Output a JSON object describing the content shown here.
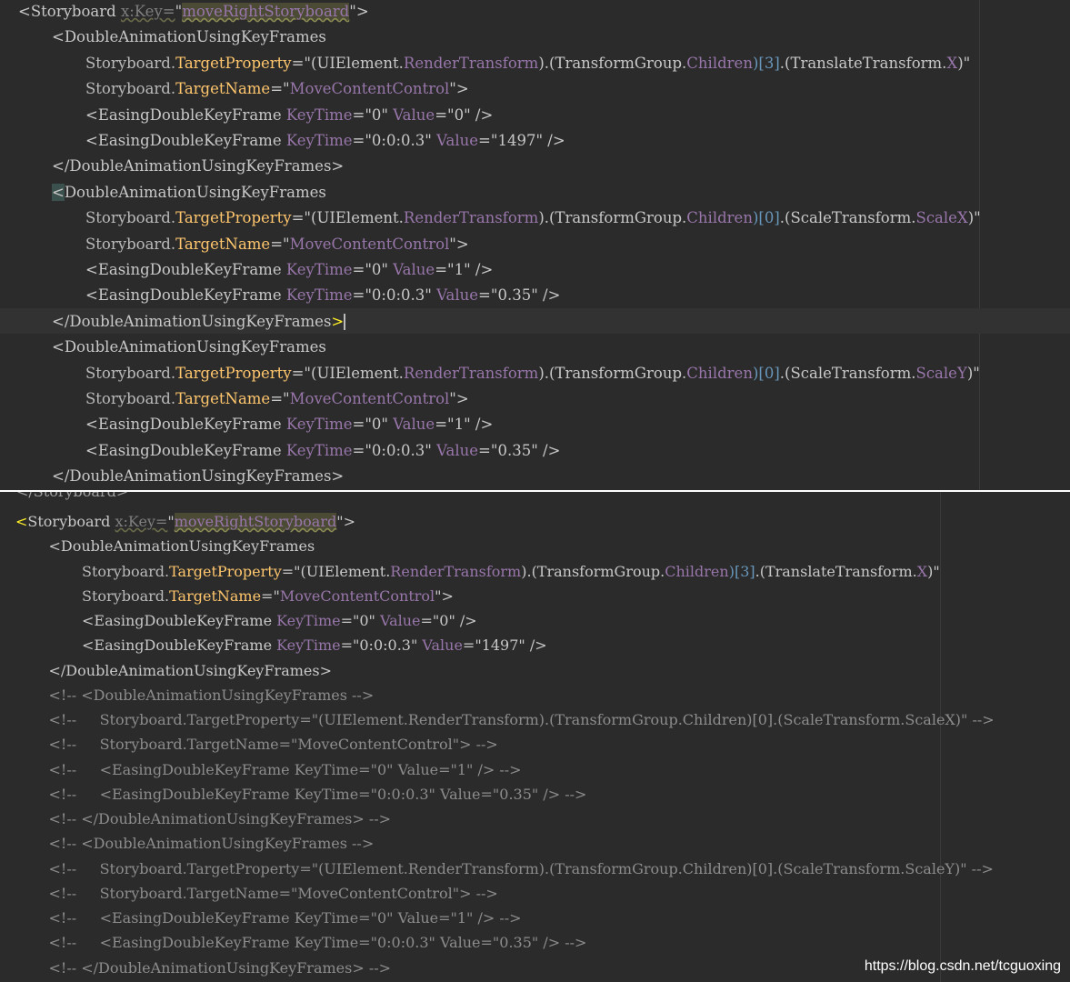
{
  "top_panel": {
    "lines": [
      {
        "indent": 0,
        "tokens": [
          {
            "t": "<Storyboard ",
            "c": "tag"
          },
          {
            "t": "x:Key=",
            "c": "key"
          },
          {
            "t": "\"",
            "c": "strq"
          },
          {
            "t": "moveRightStoryboard",
            "c": "keyval"
          },
          {
            "t": "\">",
            "c": "strq"
          }
        ]
      },
      {
        "indent": 1,
        "tokens": [
          {
            "t": "<DoubleAnimationUsingKeyFrames",
            "c": "tag"
          }
        ]
      },
      {
        "indent": 2,
        "tokens": [
          {
            "t": "Storyboard.",
            "c": "attr"
          },
          {
            "t": "TargetProperty",
            "c": "prop"
          },
          {
            "t": "=\"(UIElement.",
            "c": "strq"
          },
          {
            "t": "RenderTransform",
            "c": "str"
          },
          {
            "t": ").(TransformGroup.",
            "c": "strq"
          },
          {
            "t": "Children",
            "c": "str"
          },
          {
            "t": ")[3]",
            "c": "num"
          },
          {
            "t": ".(TranslateTransform.",
            "c": "strq"
          },
          {
            "t": "X",
            "c": "str"
          },
          {
            "t": ")\"",
            "c": "strq"
          }
        ]
      },
      {
        "indent": 2,
        "tokens": [
          {
            "t": "Storyboard.",
            "c": "attr"
          },
          {
            "t": "TargetName",
            "c": "prop"
          },
          {
            "t": "=\"",
            "c": "strq"
          },
          {
            "t": "MoveContentControl",
            "c": "str"
          },
          {
            "t": "\">",
            "c": "strq"
          }
        ]
      },
      {
        "indent": 2,
        "tokens": [
          {
            "t": "<EasingDoubleKeyFrame ",
            "c": "tag"
          },
          {
            "t": "KeyTime",
            "c": "str"
          },
          {
            "t": "=\"0\" ",
            "c": "strq"
          },
          {
            "t": "Value",
            "c": "str"
          },
          {
            "t": "=\"0\" />",
            "c": "strq"
          }
        ]
      },
      {
        "indent": 2,
        "tokens": [
          {
            "t": "<EasingDoubleKeyFrame ",
            "c": "tag"
          },
          {
            "t": "KeyTime",
            "c": "str"
          },
          {
            "t": "=\"0:0:0.3\" ",
            "c": "strq"
          },
          {
            "t": "Value",
            "c": "str"
          },
          {
            "t": "=\"1497\" />",
            "c": "strq"
          }
        ]
      },
      {
        "indent": 1,
        "tokens": [
          {
            "t": "</DoubleAnimationUsingKeyFrames>",
            "c": "tag"
          }
        ]
      },
      {
        "indent": 1,
        "tokens": [
          {
            "t": "<",
            "c": "match"
          },
          {
            "t": "DoubleAnimationUsingKeyFrames",
            "c": "tag"
          }
        ]
      },
      {
        "indent": 2,
        "tokens": [
          {
            "t": "Storyboard.",
            "c": "attr"
          },
          {
            "t": "TargetProperty",
            "c": "prop"
          },
          {
            "t": "=\"(UIElement.",
            "c": "strq"
          },
          {
            "t": "RenderTransform",
            "c": "str"
          },
          {
            "t": ").(TransformGroup.",
            "c": "strq"
          },
          {
            "t": "Children",
            "c": "str"
          },
          {
            "t": ")[0]",
            "c": "num"
          },
          {
            "t": ".(ScaleTransform.",
            "c": "strq"
          },
          {
            "t": "ScaleX",
            "c": "str"
          },
          {
            "t": ")\"",
            "c": "strq"
          }
        ]
      },
      {
        "indent": 2,
        "tokens": [
          {
            "t": "Storyboard.",
            "c": "attr"
          },
          {
            "t": "TargetName",
            "c": "prop"
          },
          {
            "t": "=\"",
            "c": "strq"
          },
          {
            "t": "MoveContentControl",
            "c": "str"
          },
          {
            "t": "\">",
            "c": "strq"
          }
        ]
      },
      {
        "indent": 2,
        "tokens": [
          {
            "t": "<EasingDoubleKeyFrame ",
            "c": "tag"
          },
          {
            "t": "KeyTime",
            "c": "str"
          },
          {
            "t": "=\"0\" ",
            "c": "strq"
          },
          {
            "t": "Value",
            "c": "str"
          },
          {
            "t": "=\"1\" />",
            "c": "strq"
          }
        ]
      },
      {
        "indent": 2,
        "tokens": [
          {
            "t": "<EasingDoubleKeyFrame ",
            "c": "tag"
          },
          {
            "t": "KeyTime",
            "c": "str"
          },
          {
            "t": "=\"0:0:0.3\" ",
            "c": "strq"
          },
          {
            "t": "Value",
            "c": "str"
          },
          {
            "t": "=\"0.35\" />",
            "c": "strq"
          }
        ]
      },
      {
        "indent": 1,
        "current": true,
        "tokens": [
          {
            "t": "</DoubleAnimationUsingKeyFrames",
            "c": "tag"
          },
          {
            "t": ">",
            "c": "bracket"
          },
          {
            "t": "",
            "c": "caret"
          }
        ]
      },
      {
        "indent": 1,
        "tokens": [
          {
            "t": "<DoubleAnimationUsingKeyFrames",
            "c": "tag"
          }
        ]
      },
      {
        "indent": 2,
        "tokens": [
          {
            "t": "Storyboard.",
            "c": "attr"
          },
          {
            "t": "TargetProperty",
            "c": "prop"
          },
          {
            "t": "=\"(UIElement.",
            "c": "strq"
          },
          {
            "t": "RenderTransform",
            "c": "str"
          },
          {
            "t": ").(TransformGroup.",
            "c": "strq"
          },
          {
            "t": "Children",
            "c": "str"
          },
          {
            "t": ")[0]",
            "c": "num"
          },
          {
            "t": ".(ScaleTransform.",
            "c": "strq"
          },
          {
            "t": "ScaleY",
            "c": "str"
          },
          {
            "t": ")\"",
            "c": "strq"
          }
        ]
      },
      {
        "indent": 2,
        "tokens": [
          {
            "t": "Storyboard.",
            "c": "attr"
          },
          {
            "t": "TargetName",
            "c": "prop"
          },
          {
            "t": "=\"",
            "c": "strq"
          },
          {
            "t": "MoveContentControl",
            "c": "str"
          },
          {
            "t": "\">",
            "c": "strq"
          }
        ]
      },
      {
        "indent": 2,
        "tokens": [
          {
            "t": "<EasingDoubleKeyFrame ",
            "c": "tag"
          },
          {
            "t": "KeyTime",
            "c": "str"
          },
          {
            "t": "=\"0\" ",
            "c": "strq"
          },
          {
            "t": "Value",
            "c": "str"
          },
          {
            "t": "=\"1\" />",
            "c": "strq"
          }
        ]
      },
      {
        "indent": 2,
        "tokens": [
          {
            "t": "<EasingDoubleKeyFrame ",
            "c": "tag"
          },
          {
            "t": "KeyTime",
            "c": "str"
          },
          {
            "t": "=\"0:0:0.3\" ",
            "c": "strq"
          },
          {
            "t": "Value",
            "c": "str"
          },
          {
            "t": "=\"0.35\" />",
            "c": "strq"
          }
        ]
      },
      {
        "indent": 1,
        "tokens": [
          {
            "t": "</DoubleAnimationUsingKeyFrames>",
            "c": "tag"
          }
        ]
      }
    ]
  },
  "bottom_panel": {
    "partial_line": "</Storyboard>",
    "lines": [
      {
        "indent": 0,
        "tokens": [
          {
            "t": "<",
            "c": "bracket"
          },
          {
            "t": "Storyboard ",
            "c": "tag"
          },
          {
            "t": "x:Key=",
            "c": "key"
          },
          {
            "t": "\"",
            "c": "strq"
          },
          {
            "t": "moveRightStoryboard",
            "c": "keyval"
          },
          {
            "t": "\">",
            "c": "strq"
          }
        ]
      },
      {
        "indent": 1,
        "tokens": [
          {
            "t": "<DoubleAnimationUsingKeyFrames",
            "c": "tag"
          }
        ]
      },
      {
        "indent": 2,
        "tokens": [
          {
            "t": "Storyboard.",
            "c": "attr"
          },
          {
            "t": "TargetProperty",
            "c": "prop"
          },
          {
            "t": "=\"(UIElement.",
            "c": "strq"
          },
          {
            "t": "RenderTransform",
            "c": "str"
          },
          {
            "t": ").(TransformGroup.",
            "c": "strq"
          },
          {
            "t": "Children",
            "c": "str"
          },
          {
            "t": ")[3]",
            "c": "num"
          },
          {
            "t": ".(TranslateTransform.",
            "c": "strq"
          },
          {
            "t": "X",
            "c": "str"
          },
          {
            "t": ")\"",
            "c": "strq"
          }
        ]
      },
      {
        "indent": 2,
        "tokens": [
          {
            "t": "Storyboard.",
            "c": "attr"
          },
          {
            "t": "TargetName",
            "c": "prop"
          },
          {
            "t": "=\"",
            "c": "strq"
          },
          {
            "t": "MoveContentControl",
            "c": "str"
          },
          {
            "t": "\">",
            "c": "strq"
          }
        ]
      },
      {
        "indent": 2,
        "tokens": [
          {
            "t": "<EasingDoubleKeyFrame ",
            "c": "tag"
          },
          {
            "t": "KeyTime",
            "c": "str"
          },
          {
            "t": "=\"0\" ",
            "c": "strq"
          },
          {
            "t": "Value",
            "c": "str"
          },
          {
            "t": "=\"0\" />",
            "c": "strq"
          }
        ]
      },
      {
        "indent": 2,
        "tokens": [
          {
            "t": "<EasingDoubleKeyFrame ",
            "c": "tag"
          },
          {
            "t": "KeyTime",
            "c": "str"
          },
          {
            "t": "=\"0:0:0.3\" ",
            "c": "strq"
          },
          {
            "t": "Value",
            "c": "str"
          },
          {
            "t": "=\"1497\" />",
            "c": "strq"
          }
        ]
      },
      {
        "indent": 1,
        "tokens": [
          {
            "t": "</DoubleAnimationUsingKeyFrames>",
            "c": "tag"
          }
        ]
      },
      {
        "indent": 1,
        "tokens": [
          {
            "t": "<!-- <DoubleAnimationUsingKeyFrames -->",
            "c": "comment"
          }
        ]
      },
      {
        "indent": 1,
        "tokens": [
          {
            "t": "<!--     Storyboard.TargetProperty=\"(UIElement.RenderTransform).(TransformGroup.Children)[0].(ScaleTransform.ScaleX)\" -->",
            "c": "comment"
          }
        ]
      },
      {
        "indent": 1,
        "tokens": [
          {
            "t": "<!--     Storyboard.TargetName=\"MoveContentControl\"> -->",
            "c": "comment"
          }
        ]
      },
      {
        "indent": 1,
        "tokens": [
          {
            "t": "<!--     <EasingDoubleKeyFrame KeyTime=\"0\" Value=\"1\" /> -->",
            "c": "comment"
          }
        ]
      },
      {
        "indent": 1,
        "tokens": [
          {
            "t": "<!--     <EasingDoubleKeyFrame KeyTime=\"0:0:0.3\" Value=\"0.35\" /> -->",
            "c": "comment"
          }
        ]
      },
      {
        "indent": 1,
        "tokens": [
          {
            "t": "<!-- </DoubleAnimationUsingKeyFrames> -->",
            "c": "comment"
          }
        ]
      },
      {
        "indent": 1,
        "tokens": [
          {
            "t": "<!-- <DoubleAnimationUsingKeyFrames -->",
            "c": "comment"
          }
        ]
      },
      {
        "indent": 1,
        "tokens": [
          {
            "t": "<!--     Storyboard.TargetProperty=\"(UIElement.RenderTransform).(TransformGroup.Children)[0].(ScaleTransform.ScaleY)\" -->",
            "c": "comment"
          }
        ]
      },
      {
        "indent": 1,
        "tokens": [
          {
            "t": "<!--     Storyboard.TargetName=\"MoveContentControl\"> -->",
            "c": "comment"
          }
        ]
      },
      {
        "indent": 1,
        "tokens": [
          {
            "t": "<!--     <EasingDoubleKeyFrame KeyTime=\"0\" Value=\"1\" /> -->",
            "c": "comment"
          }
        ]
      },
      {
        "indent": 1,
        "tokens": [
          {
            "t": "<!--     <EasingDoubleKeyFrame KeyTime=\"0:0:0.3\" Value=\"0.35\" /> -->",
            "c": "comment"
          }
        ]
      },
      {
        "indent": 1,
        "tokens": [
          {
            "t": "<!-- </DoubleAnimationUsingKeyFrames> -->",
            "c": "comment"
          }
        ]
      }
    ]
  },
  "watermark": "https://blog.csdn.net/tcguoxing",
  "colors": {
    "editor_bg": "#2b2b2b",
    "tag": "#c8c8c8",
    "property": "#ffc66d",
    "attribute_value": "#9876aa",
    "number": "#6897bb",
    "comment": "#8c8c8c",
    "bracket_match": "#ffef28"
  }
}
